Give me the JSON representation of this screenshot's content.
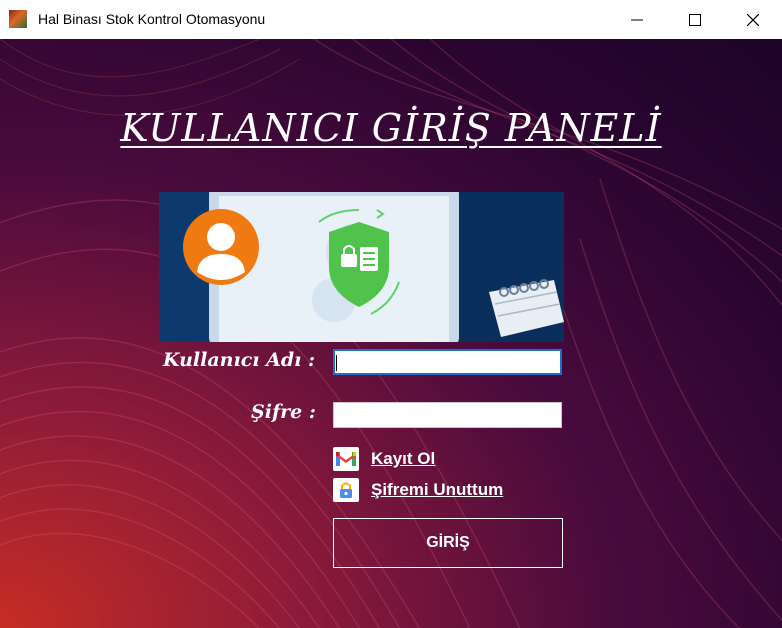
{
  "window": {
    "title": "Hal Binası Stok Kontrol Otomasyonu",
    "icon": "app-logo-icon"
  },
  "login": {
    "heading": "KULLANICI GİRİŞ PANELİ",
    "username_label": "Kullanıcı Adı :",
    "username_value": "",
    "password_label": "Şifre :",
    "password_value": "",
    "register_link": "Kayıt Ol",
    "register_icon": "gmail-icon",
    "forgot_link": "Şifremi Unuttum",
    "forgot_icon": "lock-icon",
    "login_button": "GİRİŞ"
  },
  "colors": {
    "background_dark": "#1d0428",
    "background_accent": "#c72d24",
    "focus_border": "#1f6fc4"
  }
}
